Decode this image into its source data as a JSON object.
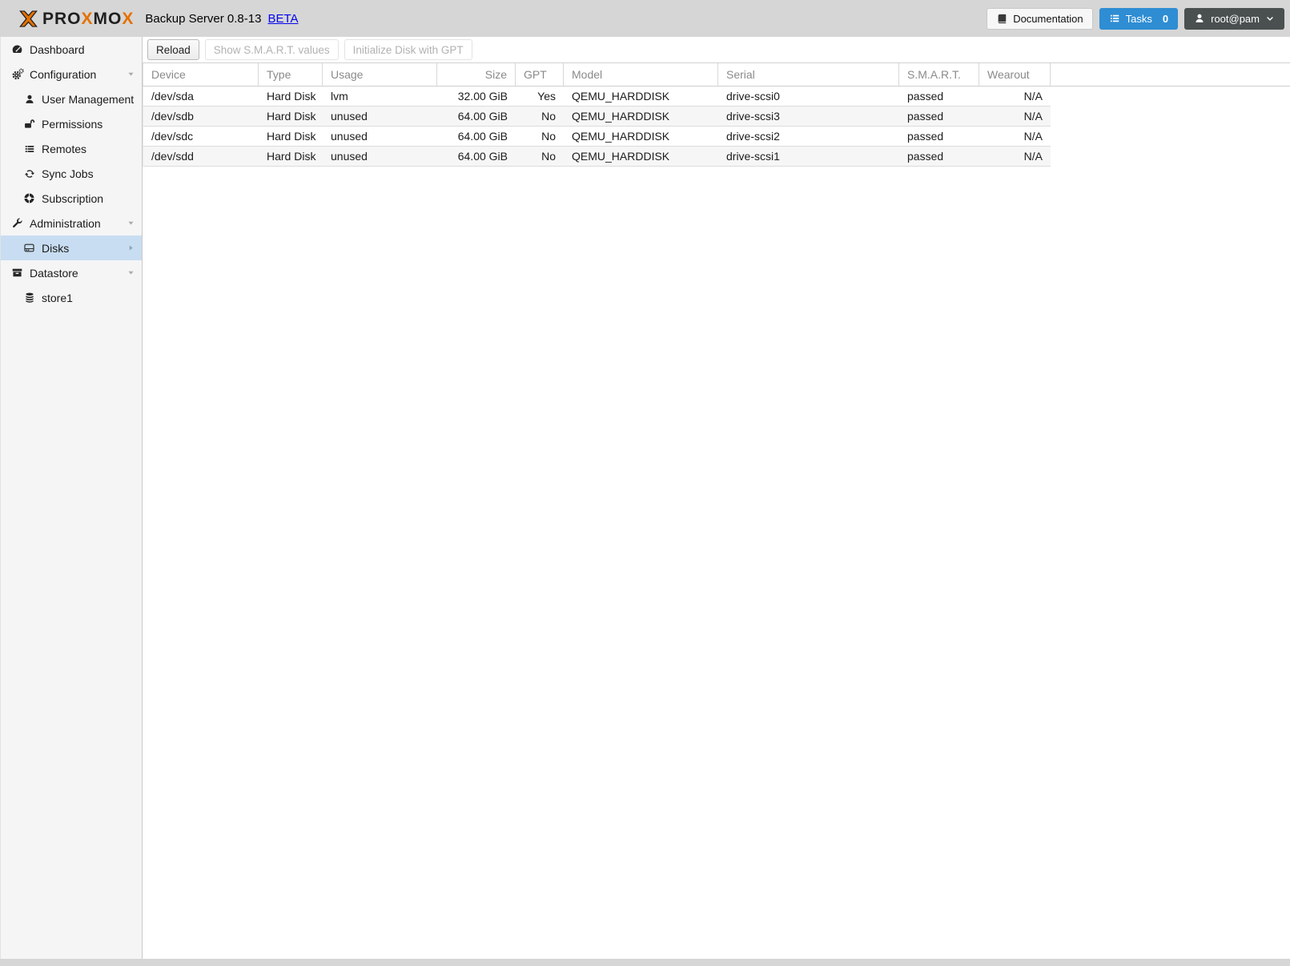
{
  "header": {
    "logo": {
      "mark_icon": "proxmox-x-icon",
      "part1": "PRO",
      "part2": "X",
      "part3": "MO",
      "part4": "X"
    },
    "title": "Backup Server 0.8-13",
    "beta_link": "BETA",
    "documentation_button": "Documentation",
    "tasks_button": "Tasks",
    "tasks_count": "0",
    "user_menu": "root@pam"
  },
  "colors": {
    "brand_orange": "#e57000",
    "tasks_blue": "#2e8dd3",
    "user_button_gray": "#4a4f4f",
    "selection_blue": "#c8ddf1",
    "link_blue": "#0404ee"
  },
  "sidebar": {
    "items": [
      {
        "label": "Dashboard",
        "icon": "dashboard-icon",
        "level": 0
      },
      {
        "label": "Configuration",
        "icon": "gears-icon",
        "level": 0,
        "expanded": true
      },
      {
        "label": "User Management",
        "icon": "user-icon",
        "level": 1
      },
      {
        "label": "Permissions",
        "icon": "unlock-icon",
        "level": 1
      },
      {
        "label": "Remotes",
        "icon": "list-bars-icon",
        "level": 1
      },
      {
        "label": "Sync Jobs",
        "icon": "sync-icon",
        "level": 1
      },
      {
        "label": "Subscription",
        "icon": "life-ring-icon",
        "level": 1
      },
      {
        "label": "Administration",
        "icon": "wrench-icon",
        "level": 0,
        "expanded": true
      },
      {
        "label": "Disks",
        "icon": "hdd-icon",
        "level": 1,
        "selected": true
      },
      {
        "label": "Datastore",
        "icon": "archive-icon",
        "level": 0,
        "expanded": true
      },
      {
        "label": "store1",
        "icon": "database-icon",
        "level": 1
      }
    ]
  },
  "toolbar": {
    "reload_label": "Reload",
    "show_smart_label": "Show S.M.A.R.T. values",
    "init_gpt_label": "Initialize Disk with GPT"
  },
  "table": {
    "columns": [
      "Device",
      "Type",
      "Usage",
      "Size",
      "GPT",
      "Model",
      "Serial",
      "S.M.A.R.T.",
      "Wearout"
    ],
    "rows": [
      {
        "device": "/dev/sda",
        "type": "Hard Disk",
        "usage": "lvm",
        "size": "32.00 GiB",
        "gpt": "Yes",
        "model": "QEMU_HARDDISK",
        "serial": "drive-scsi0",
        "smart": "passed",
        "wearout": "N/A"
      },
      {
        "device": "/dev/sdb",
        "type": "Hard Disk",
        "usage": "unused",
        "size": "64.00 GiB",
        "gpt": "No",
        "model": "QEMU_HARDDISK",
        "serial": "drive-scsi3",
        "smart": "passed",
        "wearout": "N/A"
      },
      {
        "device": "/dev/sdc",
        "type": "Hard Disk",
        "usage": "unused",
        "size": "64.00 GiB",
        "gpt": "No",
        "model": "QEMU_HARDDISK",
        "serial": "drive-scsi2",
        "smart": "passed",
        "wearout": "N/A"
      },
      {
        "device": "/dev/sdd",
        "type": "Hard Disk",
        "usage": "unused",
        "size": "64.00 GiB",
        "gpt": "No",
        "model": "QEMU_HARDDISK",
        "serial": "drive-scsi1",
        "smart": "passed",
        "wearout": "N/A"
      }
    ]
  }
}
